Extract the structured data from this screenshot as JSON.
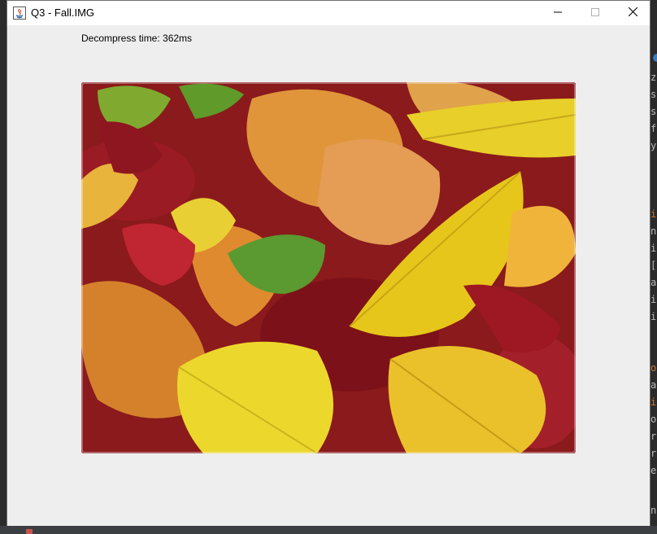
{
  "window": {
    "title": "Q3 - Fall.IMG",
    "app_icon": "java-icon",
    "controls": {
      "minimize_icon": "minimize-icon",
      "maximize_icon": "maximize-icon",
      "close_icon": "close-icon"
    }
  },
  "content": {
    "decompress_label": "Decompress time: 362ms",
    "image_description_icon": "photo-autumn-leaves"
  },
  "background_editor": {
    "visible_chars": [
      "z",
      "s",
      "s",
      "f",
      "y",
      "i",
      "n",
      "i",
      "[",
      "a",
      "i",
      "i",
      "o",
      "a",
      "i",
      "o",
      "r",
      "r",
      "e",
      "n"
    ]
  },
  "colors": {
    "titlebar": "#ffffff",
    "window_bg": "#eeeeee",
    "editor_bg": "#2b2b2b"
  }
}
